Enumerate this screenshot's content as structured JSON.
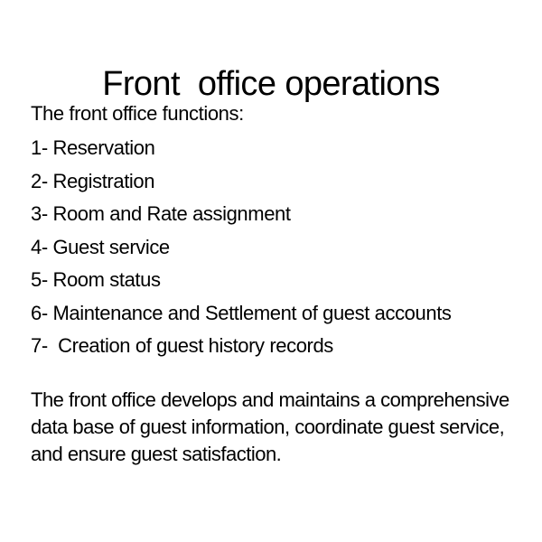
{
  "slide": {
    "title": "Front  office operations",
    "intro": "The front office functions:",
    "functions": [
      "1- Reservation",
      "2- Registration",
      "3- Room and Rate assignment",
      "4- Guest service",
      "5- Room status",
      "6- Maintenance and Settlement of guest accounts",
      "7-  Creation of guest history records"
    ],
    "summary": "The front office develops and maintains a comprehensive data base of guest information, coordinate guest service, and ensure guest satisfaction.",
    "colors": {
      "background": "#ffffff",
      "text": "#000000"
    }
  }
}
